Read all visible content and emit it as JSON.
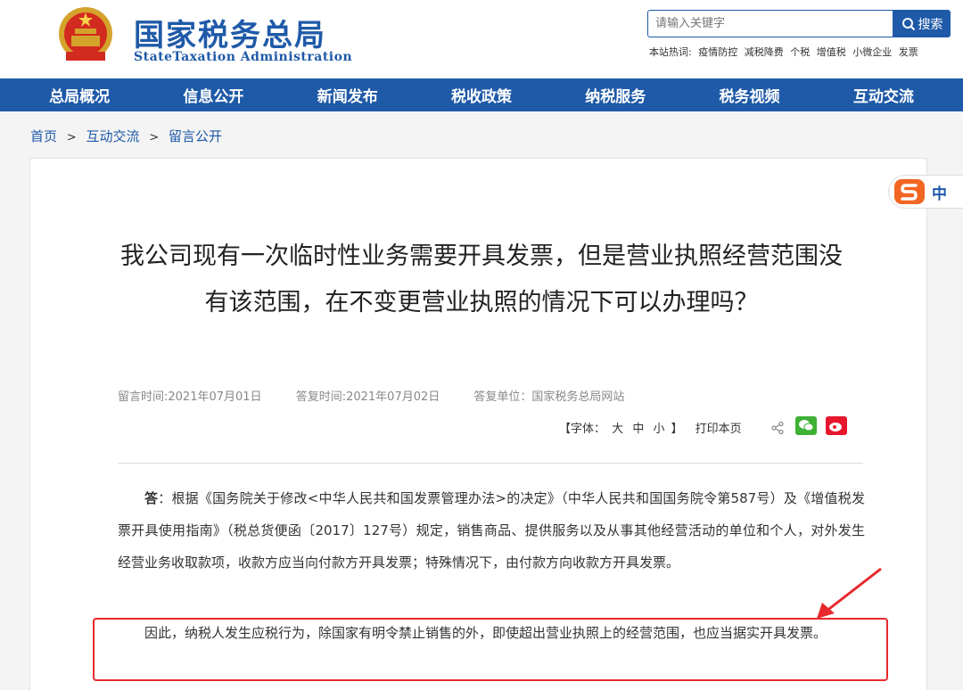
{
  "header": {
    "logo_cn": "国家税务总局",
    "logo_en": "StateTaxation Administration",
    "search": {
      "placeholder": "请输入关键字",
      "button_label": "搜索"
    },
    "hot_label": "本站热词:",
    "hot_words": [
      "疫情防控",
      "减税降费",
      "个税",
      "增值税",
      "小微企业",
      "发票"
    ]
  },
  "nav": {
    "items": [
      "总局概况",
      "信息公开",
      "新闻发布",
      "税收政策",
      "纳税服务",
      "税务视频",
      "互动交流"
    ]
  },
  "breadcrumb": {
    "items": [
      "首页",
      "互动交流",
      "留言公开"
    ],
    "separator": ">"
  },
  "article": {
    "title": "我公司现有一次临时性业务需要开具发票，但是营业执照经营范围没有该范围，在不变更营业执照的情况下可以办理吗？",
    "meta": {
      "question_time": "留言时间:2021年07月01日",
      "answer_time": "答复时间:2021年07月02日",
      "answer_unit": "答复单位：国家税务总局网站"
    },
    "tools": {
      "font_label": "【字体：",
      "font_large": "大",
      "font_medium": "中",
      "font_small": "小",
      "font_end": "】",
      "print": "打印本页"
    },
    "answer_label": "答",
    "paragraph1": "：根据《国务院关于修改<中华人民共和国发票管理办法>的决定》（中华人民共和国国务院令第587号）及《增值税发票开具使用指南》（税总货便函〔2017〕127号）规定，销售商品、提供服务以及从事其他经营活动的单位和个人，对外发生经营业务收取款项，收款方应当向付款方开具发票；特殊情况下，由付款方向收款方开具发票。",
    "paragraph2": "因此，纳税人发生应税行为，除国家有明令禁止销售的外，即使超出营业执照上的经营范围，也应当据实开具发票。"
  },
  "ime": {
    "label": "中"
  },
  "colors": {
    "brand_blue": "#1f5aa8",
    "highlight_red": "#e8282b"
  }
}
